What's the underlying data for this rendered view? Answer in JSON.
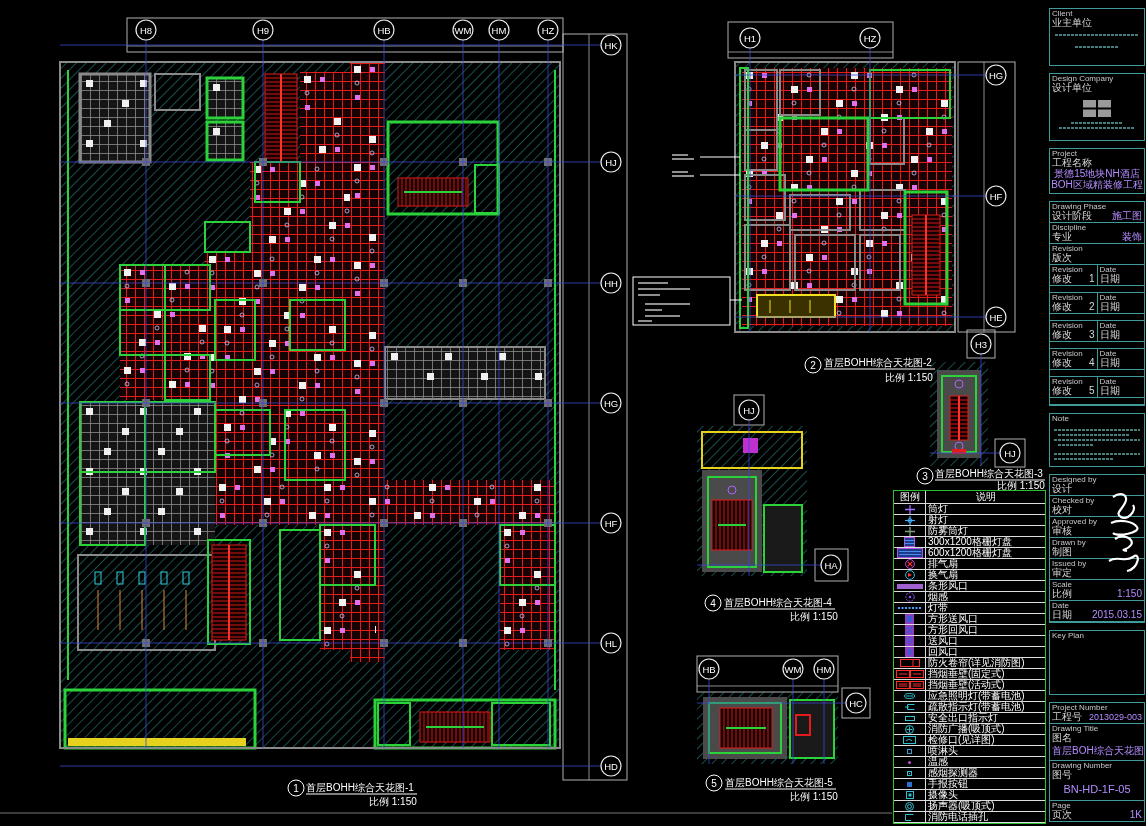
{
  "plans": [
    {
      "number": "1",
      "title": "首层BOHH综合天花图-1",
      "scale": "比例 1:150",
      "grid_axes": [
        "H8",
        "H9",
        "HB",
        "WM",
        "HM",
        "HZ",
        "HK",
        "HJ",
        "HH",
        "HG",
        "HF",
        "HL",
        "HD"
      ]
    },
    {
      "number": "2",
      "title": "首层BOHH综合天花图-2",
      "scale": "比例 1:150",
      "grid_axes": [
        "H1",
        "HZ",
        "HG",
        "HF",
        "HE"
      ]
    },
    {
      "number": "3",
      "title": "首层BOHH综合天花图-3",
      "scale": "比例 1:150",
      "grid_axes": [
        "H3",
        "HJ"
      ]
    },
    {
      "number": "4",
      "title": "首层BOHH综合天花图-4",
      "scale": "比例 1:150",
      "grid_axes": [
        "HJ",
        "HA"
      ]
    },
    {
      "number": "5",
      "title": "首层BOHH综合天花图-5",
      "scale": "比例 1:150",
      "grid_axes": [
        "HB",
        "WM",
        "HM",
        "HC"
      ]
    }
  ],
  "legend": {
    "columns": [
      "图例",
      "说明"
    ],
    "rows": [
      {
        "kind": "downlight",
        "text": "筒灯"
      },
      {
        "kind": "spotlight",
        "text": "射灯"
      },
      {
        "kind": "moistlight",
        "text": "防雾筒灯"
      },
      {
        "kind": "panel",
        "text": "300x1200格栅灯盘"
      },
      {
        "kind": "widepanel",
        "text": "600x1200格栅灯盘"
      },
      {
        "kind": "exhaust",
        "text": "排气扇"
      },
      {
        "kind": "fan",
        "text": "换气扇"
      },
      {
        "kind": "slot",
        "text": "条形风口"
      },
      {
        "kind": "detector",
        "text": "烟感"
      },
      {
        "kind": "strip",
        "text": "灯带"
      },
      {
        "kind": "supply",
        "text": "方形送风口"
      },
      {
        "kind": "return",
        "text": "方形回风口"
      },
      {
        "kind": "grille",
        "text": "送风口"
      },
      {
        "kind": "hatch",
        "text": "回风口"
      },
      {
        "kind": "shutter",
        "text": "防火卷帘(详见消防图)"
      },
      {
        "kind": "curtain",
        "text": "挡烟垂壁(固定式)"
      },
      {
        "kind": "curtainfixed",
        "text": "挡烟垂壁(活动式)"
      },
      {
        "kind": "emergency",
        "text": "应急照明灯(带蓄电池)"
      },
      {
        "kind": "exit",
        "text": "疏散指示灯(带蓄电池)"
      },
      {
        "kind": "sign",
        "text": "安全出口指示灯"
      },
      {
        "kind": "speaker",
        "text": "消防广播(吸顶式)"
      },
      {
        "kind": "access",
        "text": "检修口(见详图)"
      },
      {
        "kind": "sprinkler",
        "text": "喷淋头"
      },
      {
        "kind": "heat",
        "text": "温感"
      },
      {
        "kind": "smoke",
        "text": "感烟探测器"
      },
      {
        "kind": "button",
        "text": "手报按钮"
      },
      {
        "kind": "camera",
        "text": "摄像头"
      },
      {
        "kind": "phone",
        "text": "扬声器(吸顶式)"
      },
      {
        "kind": "socket",
        "text": "消防电话插孔"
      }
    ]
  },
  "title_block": {
    "client": {
      "label": "Client",
      "label_cn": "业主单位"
    },
    "designer": {
      "label": "Design Company",
      "label_cn": "设计单位"
    },
    "project": {
      "label": "Project",
      "label_cn": "工程名称",
      "name": [
        "景德15地块NH酒店",
        "BOH区域精装修工程"
      ]
    },
    "fields": [
      {
        "label": "Drawing Phase",
        "label_cn": "设计阶段",
        "value": "施工图"
      },
      {
        "label": "Discipline",
        "label_cn": "专业",
        "value": "装饰"
      },
      {
        "label": "Revision",
        "label_cn": "版次"
      }
    ],
    "revisions": [
      {
        "label": "Revision",
        "label_cn": "修改",
        "number": "1",
        "date_label": "Date",
        "date_label_cn": "日期"
      },
      {
        "label": "Revision",
        "label_cn": "修改",
        "number": "2",
        "date_label": "Date",
        "date_label_cn": "日期"
      },
      {
        "label": "Revision",
        "label_cn": "修改",
        "number": "3",
        "date_label": "Date",
        "date_label_cn": "日期"
      },
      {
        "label": "Revision",
        "label_cn": "修改",
        "number": "4",
        "date_label": "Date",
        "date_label_cn": "日期"
      },
      {
        "label": "Revision",
        "label_cn": "修改",
        "number": "5",
        "date_label": "Date",
        "date_label_cn": "日期"
      }
    ],
    "notes": {
      "label": "Note"
    },
    "signatures": [
      {
        "label": "Designed by",
        "label_cn": "设计"
      },
      {
        "label": "Checked by",
        "label_cn": "校对"
      },
      {
        "label": "Approved by",
        "label_cn": "审核"
      },
      {
        "label": "Drawn by",
        "label_cn": "制图"
      },
      {
        "label": "Issued by",
        "label_cn": "审定"
      }
    ],
    "scale": {
      "label": "Scale",
      "label_cn": "比例",
      "value": "1:150"
    },
    "date": {
      "label": "Date",
      "label_cn": "日期",
      "value": "2015.03.15"
    },
    "key_plan": {
      "label": "Key Plan"
    },
    "project_number": {
      "label": "Project Number",
      "label_cn": "工程号",
      "value": "2013029-003"
    },
    "drawing_title": {
      "label": "Drawing Title",
      "label_cn": "图名",
      "value": "首层BOH综合天花图"
    },
    "drawing_number": {
      "label": "Drawing Number",
      "label_cn": "图号",
      "value": "BN-HD-1F-05"
    },
    "page": {
      "label": "Page",
      "label_cn": "页次",
      "value": "1K"
    }
  }
}
